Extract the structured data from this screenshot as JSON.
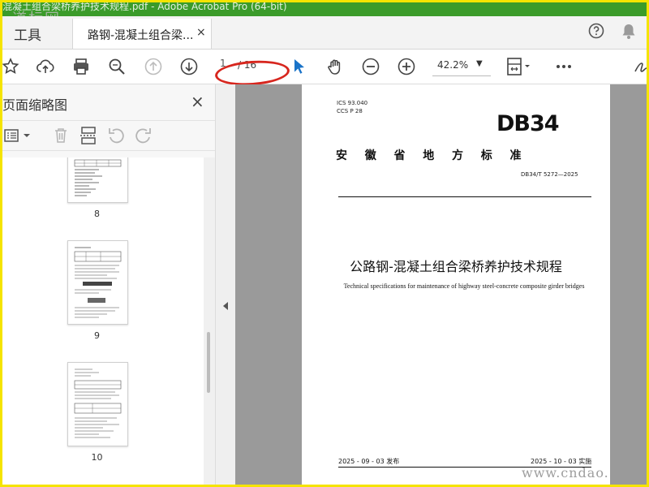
{
  "window": {
    "title": "混凝土组合梁桥养护技术规程.pdf - Adobe Acrobat Pro (64-bit)"
  },
  "watermark": {
    "top": "道标网",
    "bottom": "www.cndao."
  },
  "tabs": {
    "tools": "工具",
    "document": "路钢-混凝土组合梁...",
    "close": "×"
  },
  "toolbar": {
    "page_current": "1",
    "page_total": "/ 16",
    "zoom": "42.2%",
    "zoom_caret": "▼"
  },
  "sidebar": {
    "title": "页面缩略图",
    "close": "×",
    "thumbnails": [
      {
        "label": "8"
      },
      {
        "label": "9"
      },
      {
        "label": "10"
      }
    ]
  },
  "document": {
    "ics": "ICS  93.040",
    "ccs": "CCS  P 28",
    "logo": "DB34",
    "standard_type": "安  徽  省  地  方  标  准",
    "code": "DB34/T 5272—2025",
    "title_cn": "公路钢-混凝土组合梁桥养护技术规程",
    "title_en": "Technical specifications for maintenance of highway steel-concrete composite girder bridges",
    "issue_date": "2025 - 09 - 03 发布",
    "impl_date": "2025 - 10 - 03 实施"
  },
  "colors": {
    "titlebar": "#3b9b2a",
    "frame": "#f5e400",
    "annotation": "#d7261e",
    "select_tool": "#1a73c8"
  },
  "icons": [
    "star-icon",
    "cloud-upload-icon",
    "print-icon",
    "zoom-search-icon",
    "page-up-icon",
    "page-down-icon",
    "select-arrow-icon",
    "hand-icon",
    "zoom-out-icon",
    "zoom-in-icon",
    "page-fit-icon",
    "more-icon",
    "sign-icon",
    "help-icon",
    "bell-icon",
    "options-icon",
    "trash-icon",
    "insert-page-icon",
    "undo-icon",
    "redo-icon"
  ]
}
